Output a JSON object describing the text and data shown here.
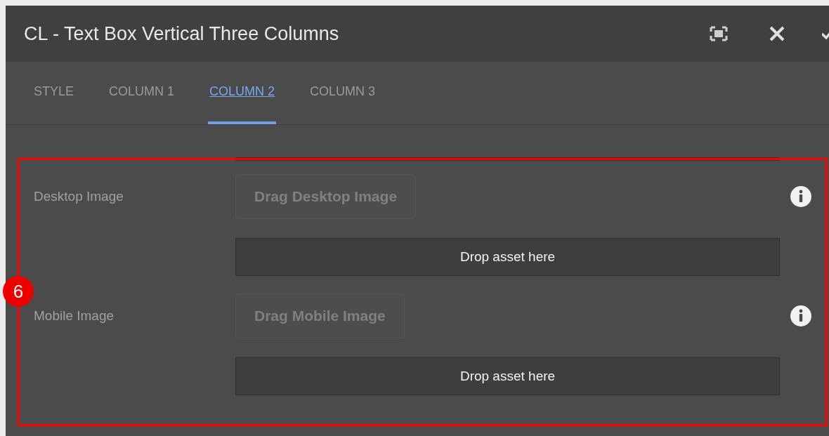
{
  "window": {
    "title": "CL - Text Box Vertical Three Columns"
  },
  "tabs": [
    {
      "label": "STYLE",
      "selected": false
    },
    {
      "label": "COLUMN 1",
      "selected": false
    },
    {
      "label": "COLUMN 2",
      "selected": true
    },
    {
      "label": "COLUMN 3",
      "selected": false
    }
  ],
  "fields": [
    {
      "label": "Desktop Image",
      "drag_label": "Drag Desktop Image",
      "drop_label": "Drop asset here"
    },
    {
      "label": "Mobile Image",
      "drag_label": "Drag Mobile Image",
      "drop_label": "Drop asset here"
    }
  ],
  "annotation": {
    "number": "6"
  }
}
